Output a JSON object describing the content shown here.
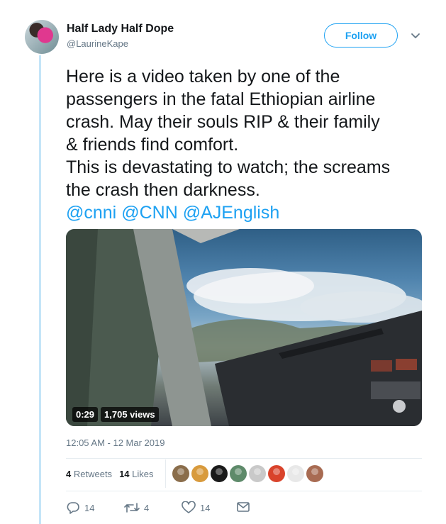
{
  "author": {
    "name": "Half Lady Half Dope",
    "handle": "@LaurineKape",
    "avatar_icon": "profile-avatar"
  },
  "follow_label": "Follow",
  "tweet": {
    "lines": [
      "Here is a video taken by one of the",
      "passengers in the fatal Ethiopian airline",
      "crash. May their souls RIP & their family",
      "& friends find comfort.",
      "This is devastating to watch; the screams",
      "the crash then darkness."
    ],
    "mentions": [
      "@cnni",
      "@CNN",
      "@AJEnglish"
    ]
  },
  "video": {
    "duration": "0:29",
    "views": "1,705 views"
  },
  "timestamp": "12:05 AM - 12 Mar 2019",
  "stats": {
    "retweets_count": "4",
    "retweets_label": "Retweets",
    "likes_count": "14",
    "likes_label": "Likes"
  },
  "likers": [
    {
      "color": "#8a6d4b"
    },
    {
      "color": "#d89a3c"
    },
    {
      "color": "#1a1a1a"
    },
    {
      "color": "#5e8a6a"
    },
    {
      "color": "#c9c9c9"
    },
    {
      "color": "#d9432b"
    },
    {
      "color": "#e8e8e8"
    },
    {
      "color": "#a86b52"
    }
  ],
  "actions": {
    "reply_count": "14",
    "retweet_count": "4",
    "like_count": "14"
  },
  "colors": {
    "accent": "#1da1f2",
    "secondary_text": "#657786",
    "thread_line": "#c4e5f8"
  }
}
